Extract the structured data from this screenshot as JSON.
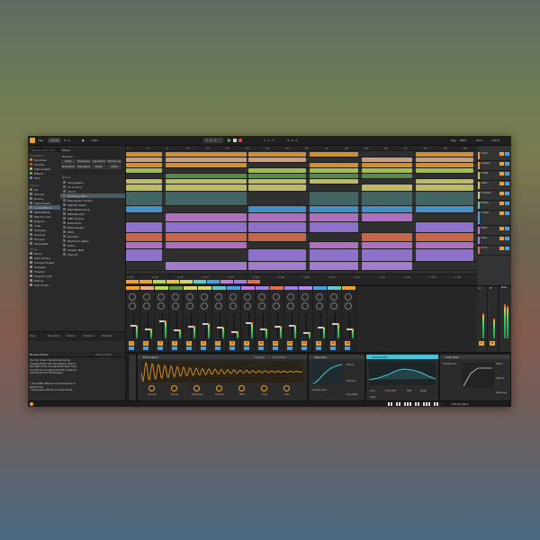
{
  "app": {
    "title": "Ableton Live"
  },
  "topbar": {
    "tap": "Tap",
    "tempo": "120.00",
    "sig": "4 / 4",
    "metro_label": "●",
    "bar": "1 Bar",
    "position": "1 . 1 . 1",
    "loop_start": "1 . 1 . 1",
    "loop_len": "4 . 0 . 0",
    "key": "Key",
    "midi": "MIDI",
    "cpu": "29 %",
    "zoom": "100 %"
  },
  "browser": {
    "search_placeholder": "Search (Ctrl + F)",
    "collections_title": "Collections",
    "collections": [
      {
        "label": "Favorites",
        "color": "#f08a22"
      },
      {
        "label": "Sounds",
        "color": "#e04c4c"
      },
      {
        "label": "Instruments",
        "color": "#e8c43a"
      },
      {
        "label": "Effects",
        "color": "#5ec25e"
      },
      {
        "label": "Test",
        "color": "#4aa0e0"
      }
    ],
    "library_title": "Library",
    "library": [
      "All",
      "Sounds",
      "Drums",
      "Instruments",
      "Audio Effects",
      "MIDI Effects",
      "Max for Live",
      "Plug-Ins",
      "Clips",
      "Samples",
      "Grooves",
      "Tunings",
      "Templates"
    ],
    "library_selected": 4,
    "places_title": "Places",
    "places": [
      "Packs",
      "User Library",
      "Current Project",
      "Samples",
      "Projects",
      "Projects (old)",
      "Demos",
      "Add Folder..."
    ],
    "filters_title": "Filters",
    "filter_tag": "Random",
    "filter_chips": [
      "Delay",
      "Expression",
      "Generative",
      "Harmony & Scale",
      "Modulation",
      "Modulators",
      "Notes",
      "Utility"
    ],
    "results_title": "Name",
    "results": [
      "Arpeggiator",
      "CC Control",
      "Chord",
      "Envelope MIDI",
      "Expression Control",
      "Melodic Steps",
      "MIDI Effect Rack",
      "MIDI Monitor",
      "MPE Control",
      "Note Echo",
      "Note Length",
      "Pitch",
      "Random",
      "Rhythmic Steps",
      "Scale",
      "Shaper MIDI",
      "Velocity"
    ],
    "results_selected": 3,
    "preview_label": "Raw",
    "preview_items": [
      "Raw",
      "Quantize",
      "Timing",
      "Random",
      "Velocity"
    ]
  },
  "info": {
    "title": "Browse Notes",
    "groove_label": "Groove Pool",
    "body": "You can move clips and devices by dragging them into the Session View or the right of the Arrangement View. Clips can also be arranged and then replaced with those from the Browser.",
    "tips": [
      "Drop MIDI effects and instruments on MIDI tracks.",
      "Drop audio effects on audio tracks."
    ]
  },
  "ruler": [
    "1",
    "5",
    "9",
    "13",
    "17",
    "21",
    "25",
    "29",
    "33",
    "37",
    "41",
    "45",
    "49",
    "53",
    "57",
    "61",
    "65",
    "69"
  ],
  "time_ruler": [
    "0:00",
    "0:08",
    "0:16",
    "0:24",
    "0:32",
    "0:40",
    "0:48",
    "0:56",
    "1:04",
    "1:12",
    "1:20",
    "1:28",
    "1:36",
    "1:44"
  ],
  "tracks": [
    {
      "name": "1 Kick",
      "color": "#f0a02c"
    },
    {
      "name": "2 Snare",
      "color": "#f0a02c"
    },
    {
      "name": "3 Hats",
      "color": "#b4d94a"
    },
    {
      "name": "4 Perc",
      "color": "#e8c43a"
    },
    {
      "name": "5 Chords",
      "color": "#d6d26e"
    },
    {
      "name": "6 Bass",
      "color": "#64c8c8"
    },
    {
      "name": "7 Lead",
      "color": "#4aa0e0"
    },
    {
      "name": "8 Pad",
      "color": "#c47ad8"
    },
    {
      "name": "9 Vox",
      "color": "#9d7de6"
    },
    {
      "name": "10 FX",
      "color": "#e07050"
    }
  ],
  "mixer": {
    "channels": [
      "1",
      "2",
      "3",
      "4",
      "5",
      "6",
      "7",
      "8",
      "9",
      "10",
      "11",
      "12",
      "13",
      "14",
      "15",
      "16"
    ],
    "returns": [
      "A",
      "B"
    ],
    "master_label": "Main",
    "levels": [
      0.55,
      0.4,
      0.7,
      0.35,
      0.5,
      0.6,
      0.45,
      0.3,
      0.65,
      0.4,
      0.5,
      0.55,
      0.25,
      0.45,
      0.6,
      0.38
    ]
  },
  "devices": {
    "instrument": {
      "title": "Drum Rack",
      "sample": "Sample",
      "mode": "Overdrive",
      "knobs": [
        "Volume",
        "Decay",
        "Transpose",
        "Detune",
        "Filter",
        "Freq",
        "Res"
      ]
    },
    "saturator": {
      "title": "Saturator",
      "drive": "Drive",
      "output": "Output",
      "dry_wet": "Dry/Wet",
      "curve": "Analog Clip"
    },
    "eq": {
      "title": "Channel EQ",
      "low": "Low",
      "mid": "Mid",
      "high": "High",
      "freq": "1.60 kHz",
      "gain": "Gain"
    },
    "comp": {
      "title": "Auto Filter",
      "thresh": "Threshold",
      "ratio": "Ratio",
      "attack": "Attack",
      "release": "Release"
    }
  },
  "status": {
    "left": "",
    "right": "1-Drum Rack"
  },
  "colors": {
    "accent": "#f0a02c",
    "bg": "#2d2d2d"
  }
}
